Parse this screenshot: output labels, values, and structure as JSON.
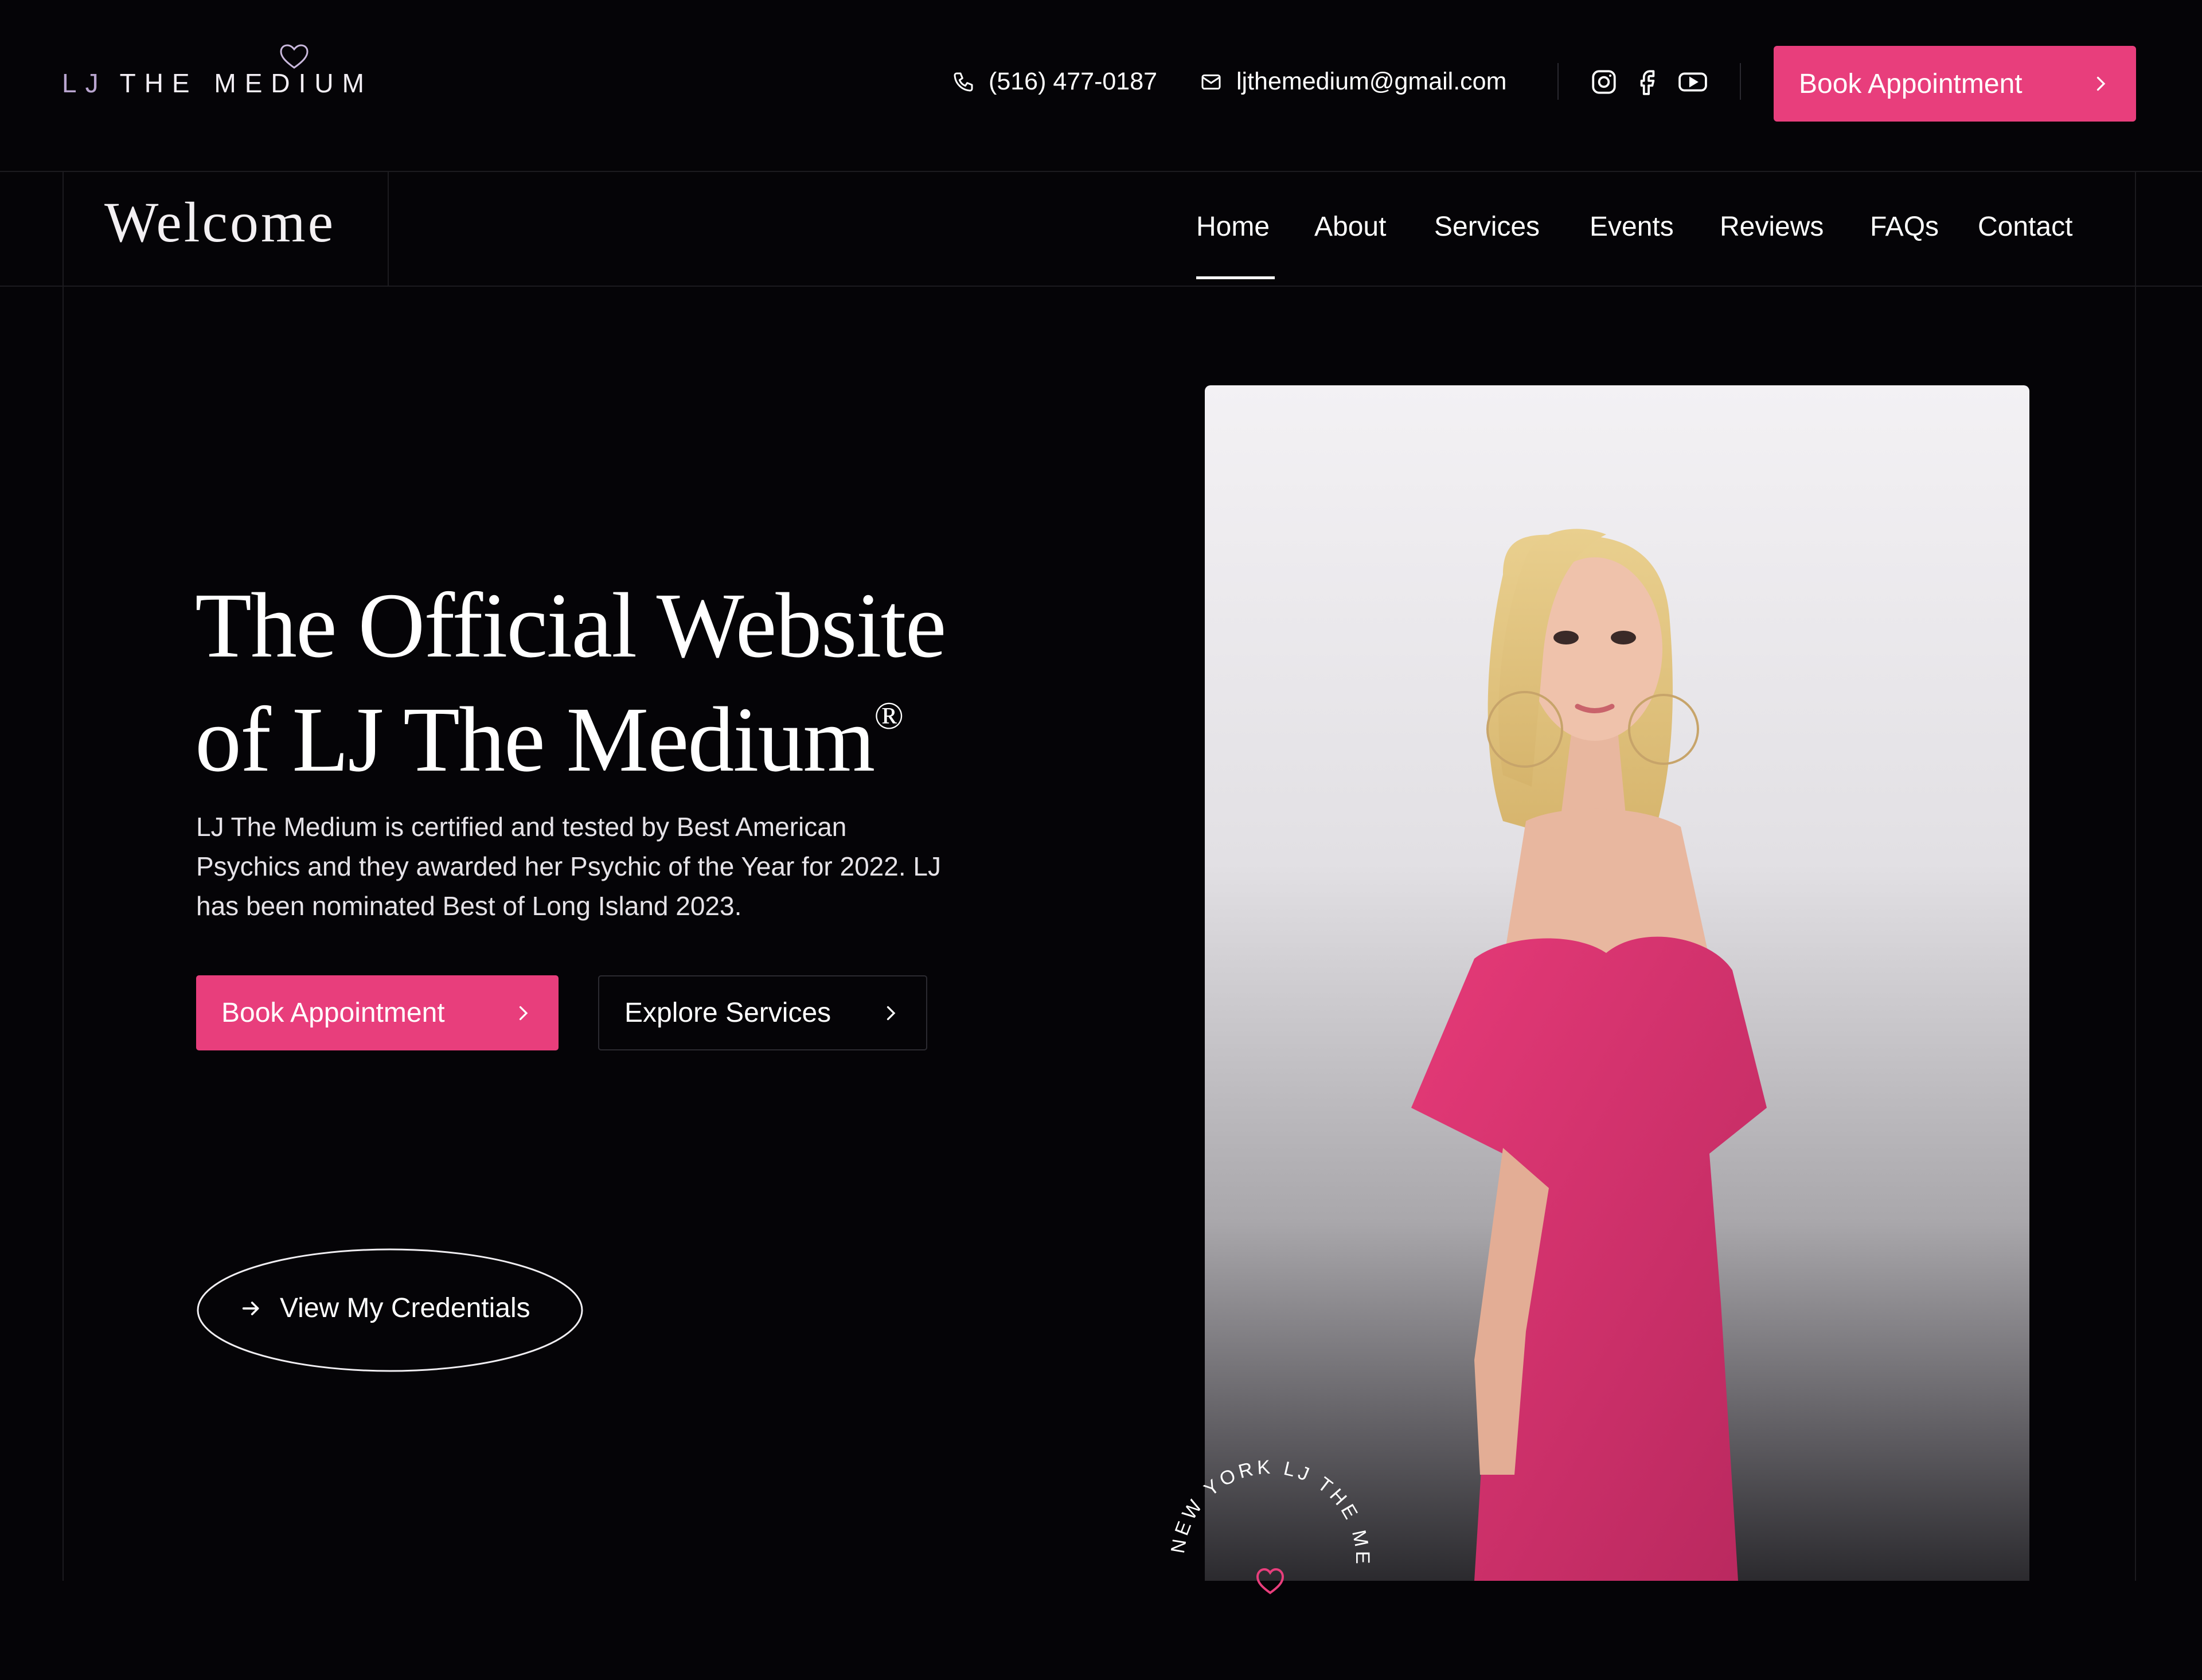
{
  "brand": {
    "logo_prefix": "LJ",
    "logo_text": "THE MEDIUM",
    "accent_color": "#e83e7c",
    "logo_heart_icon": "heart-icon"
  },
  "header": {
    "phone": "(516) 477-0187",
    "email": "ljthemedium@gmail.com",
    "social": [
      "instagram-icon",
      "facebook-icon",
      "youtube-icon"
    ],
    "cta_label": "Book Appointment"
  },
  "nav": {
    "welcome": "Welcome",
    "items": [
      {
        "label": "Home",
        "active": true
      },
      {
        "label": "About"
      },
      {
        "label": "Services"
      },
      {
        "label": "Events"
      },
      {
        "label": "Reviews"
      },
      {
        "label": "FAQs"
      },
      {
        "label": "Contact"
      }
    ]
  },
  "hero": {
    "title_line1": "The Official Website",
    "title_line2": "of LJ The Medium",
    "title_mark": "®",
    "description": "LJ The Medium is certified and tested by Best American Psychics and they awarded her Psychic of the Year for 2022. LJ has been nominated Best of Long Island 2023.",
    "primary_button": "Book Appointment",
    "secondary_button": "Explore Services",
    "credentials_link": "View My Credentials"
  },
  "badge": {
    "text_left": "NEW YORK",
    "text_right": "LJ THE MEDIUM"
  }
}
